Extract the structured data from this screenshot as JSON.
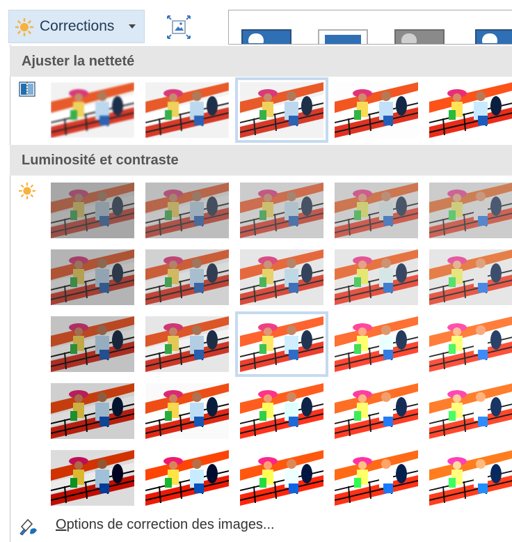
{
  "toolbar": {
    "corrections_label": "Corrections",
    "corrections_icon": "sun-icon",
    "compress_icon": "compress-pictures-icon"
  },
  "sections": {
    "sharpen": {
      "title": "Ajuster la netteté",
      "icon": "sharpen-icon",
      "selected_index": 2
    },
    "brightness": {
      "title": "Luminosité et contraste",
      "icon": "sun-icon",
      "selected_row": 2,
      "selected_col": 2
    }
  },
  "footer": {
    "link_first_letter": "O",
    "link_rest": "ptions de correction des images..."
  },
  "colors": {
    "selection": "#c5daf0",
    "header_bg": "#e6e6e6",
    "button_bg": "#dbe8f5"
  }
}
